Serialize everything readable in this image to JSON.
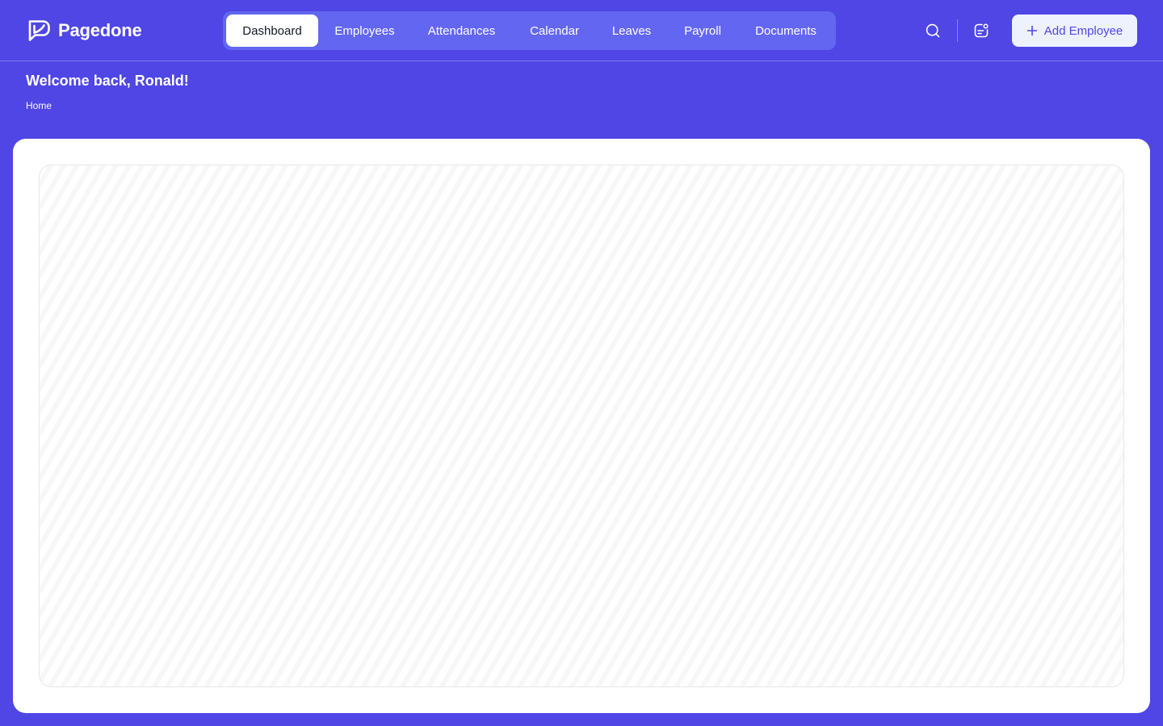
{
  "brand": {
    "name": "Pagedone",
    "logo_icon": "pagedone-logo-icon"
  },
  "nav": {
    "tabs": [
      {
        "label": "Dashboard",
        "active": true
      },
      {
        "label": "Employees",
        "active": false
      },
      {
        "label": "Attendances",
        "active": false
      },
      {
        "label": "Calendar",
        "active": false
      },
      {
        "label": "Leaves",
        "active": false
      },
      {
        "label": "Payroll",
        "active": false
      },
      {
        "label": "Documents",
        "active": false
      }
    ]
  },
  "header_actions": {
    "search_icon": "search-icon",
    "notification_icon": "notification-icon",
    "add_button": {
      "label": "Add Employee",
      "icon": "plus-icon"
    }
  },
  "page": {
    "welcome": "Welcome back, Ronald!",
    "breadcrumb": "Home"
  },
  "colors": {
    "brand_background": "#4F46E5",
    "nav_background": "#6366F1",
    "button_background": "#EEF2FF",
    "card_background": "#FFFFFF"
  }
}
